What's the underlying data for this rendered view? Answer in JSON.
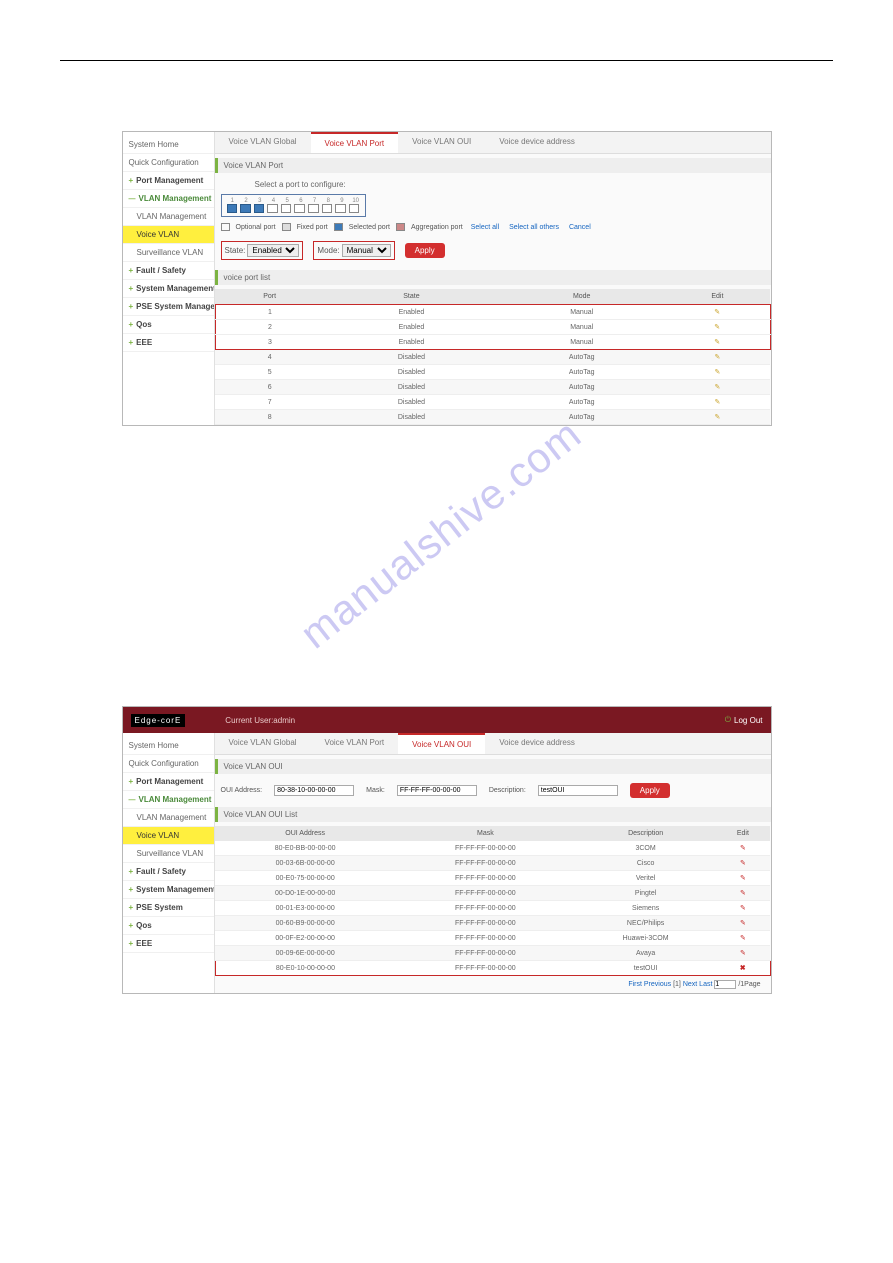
{
  "watermark": "manualshive.com",
  "sidebar": {
    "systemHome": "System Home",
    "quickConfig": "Quick Configuration",
    "portMgmt": "Port Management",
    "vlanMgmt": "VLAN Management",
    "vlanMgmtSub": "VLAN Management",
    "voiceVlan": "Voice VLAN",
    "survVlan": "Surveillance VLAN",
    "faultSafety": "Fault / Safety",
    "sysMgmt": "System Management",
    "pseSystem": "PSE System Management",
    "pseSystem2": "PSE System",
    "qos": "Qos",
    "eee": "EEE"
  },
  "fig1": {
    "tabs": [
      "Voice VLAN Global",
      "Voice VLAN Port",
      "Voice VLAN OUI",
      "Voice device address"
    ],
    "activeTab": 1,
    "sectionTitle": "Voice VLAN Port",
    "selectLabel": "Select a port to configure:",
    "portNums": [
      "1",
      "2",
      "3",
      "4",
      "5",
      "6",
      "7",
      "8",
      "9",
      "10"
    ],
    "legend": {
      "optional": "Optional port",
      "fixed": "Fixed port",
      "selected": "Selected port",
      "agg": "Aggregation port",
      "selectAll": "Select all",
      "selectOthers": "Select all others",
      "cancel": "Cancel"
    },
    "stateLabel": "State:",
    "stateValue": "Enabled",
    "modeLabel": "Mode:",
    "modeValue": "Manual",
    "apply": "Apply",
    "listTitle": "voice port list",
    "headers": [
      "Port",
      "State",
      "Mode",
      "Edit"
    ],
    "rows": [
      {
        "port": "1",
        "state": "Enabled",
        "mode": "Manual",
        "hl": true
      },
      {
        "port": "2",
        "state": "Enabled",
        "mode": "Manual",
        "hl": true
      },
      {
        "port": "3",
        "state": "Enabled",
        "mode": "Manual",
        "hl": true
      },
      {
        "port": "4",
        "state": "Disabled",
        "mode": "AutoTag"
      },
      {
        "port": "5",
        "state": "Disabled",
        "mode": "AutoTag"
      },
      {
        "port": "6",
        "state": "Disabled",
        "mode": "AutoTag"
      },
      {
        "port": "7",
        "state": "Disabled",
        "mode": "AutoTag"
      },
      {
        "port": "8",
        "state": "Disabled",
        "mode": "AutoTag"
      }
    ]
  },
  "fig2": {
    "brand": "Edge-corE",
    "userLabel": "Current User:admin",
    "logout": "Log Out",
    "tabs": [
      "Voice VLAN Global",
      "Voice VLAN Port",
      "Voice VLAN OUI",
      "Voice device address"
    ],
    "activeTab": 2,
    "sectionTitle": "Voice VLAN OUI",
    "ouiAddrLabel": "OUI Address:",
    "ouiAddrVal": "80-38-10-00-00-00",
    "maskLabel": "Mask:",
    "maskVal": "FF-FF-FF-00-00-00",
    "descLabel": "Description:",
    "descVal": "testOUI",
    "apply": "Apply",
    "listTitle": "Voice VLAN OUI List",
    "headers": [
      "OUI Address",
      "Mask",
      "Description",
      "Edit"
    ],
    "rows": [
      {
        "oui": "80-E0-BB-00-00-00",
        "mask": "FF-FF-FF-00-00-00",
        "desc": "3COM"
      },
      {
        "oui": "00-03-6B-00-00-00",
        "mask": "FF-FF-FF-00-00-00",
        "desc": "Cisco"
      },
      {
        "oui": "00-E0-75-00-00-00",
        "mask": "FF-FF-FF-00-00-00",
        "desc": "Veritel"
      },
      {
        "oui": "00-D0-1E-00-00-00",
        "mask": "FF-FF-FF-00-00-00",
        "desc": "Pingtel"
      },
      {
        "oui": "00-01-E3-00-00-00",
        "mask": "FF-FF-FF-00-00-00",
        "desc": "Siemens"
      },
      {
        "oui": "00-60-B9-00-00-00",
        "mask": "FF-FF-FF-00-00-00",
        "desc": "NEC/Philips"
      },
      {
        "oui": "00-0F-E2-00-00-00",
        "mask": "FF-FF-FF-00-00-00",
        "desc": "Huawei-3COM"
      },
      {
        "oui": "00-09-6E-00-00-00",
        "mask": "FF-FF-FF-00-00-00",
        "desc": "Avaya"
      },
      {
        "oui": "80-E0-10-00-00-00",
        "mask": "FF-FF-FF-00-00-00",
        "desc": "testOUI",
        "del": true
      }
    ],
    "pagination": {
      "first": "First",
      "prev": "Previous",
      "page": "[1]",
      "next": "Next",
      "last": "Last",
      "pageInput": "1",
      "suffix": "/1Page"
    }
  }
}
